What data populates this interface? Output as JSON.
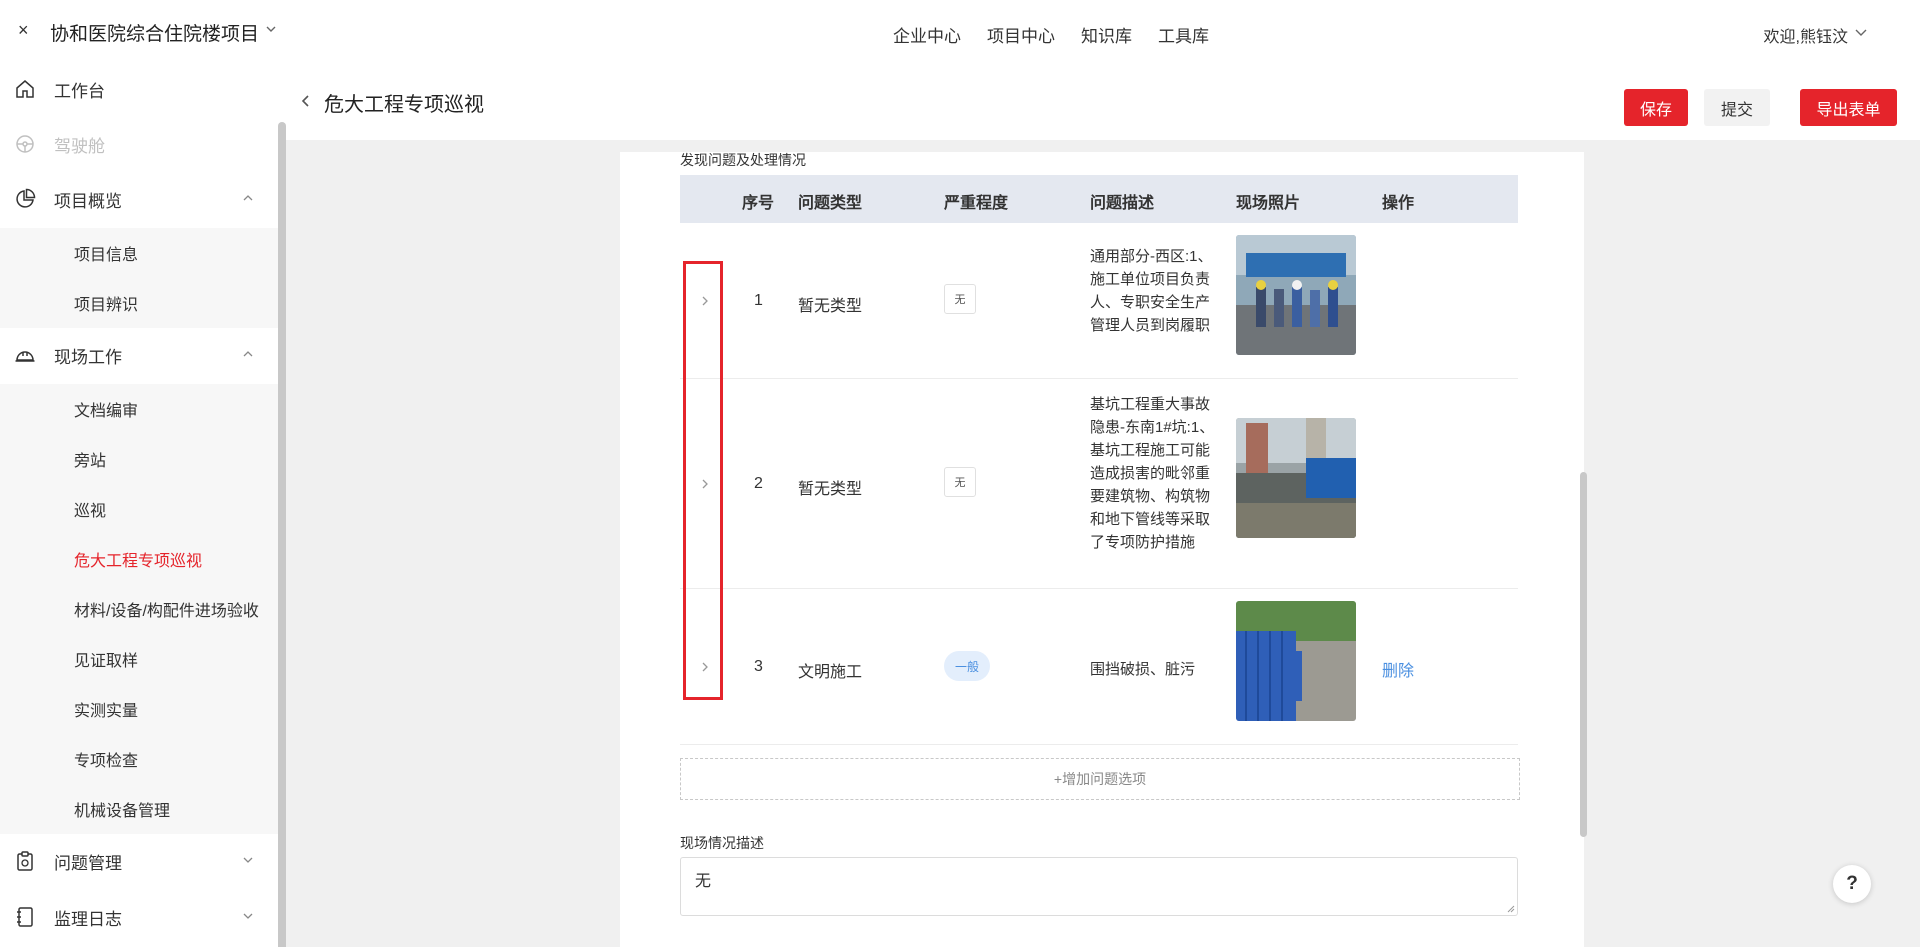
{
  "topbar": {
    "close_symbol": "×",
    "project_title": "协和医院综合住院楼项目",
    "nav": [
      "企业中心",
      "项目中心",
      "知识库",
      "工具库"
    ],
    "active_nav": "项目中心",
    "welcome": "欢迎,熊钰汶"
  },
  "sidebar": {
    "items": [
      {
        "label": "工作台",
        "icon": "home-icon"
      },
      {
        "label": "驾驶舱",
        "icon": "steering-wheel-icon",
        "disabled": true
      },
      {
        "label": "项目概览",
        "icon": "pie-chart-icon",
        "expanded": true
      },
      {
        "label": "项目信息"
      },
      {
        "label": "项目辨识"
      },
      {
        "label": "现场工作",
        "icon": "helmet-icon",
        "expanded": true
      },
      {
        "label": "文档编审"
      },
      {
        "label": "旁站"
      },
      {
        "label": "巡视"
      },
      {
        "label": "危大工程专项巡视",
        "active": true
      },
      {
        "label": "材料/设备/构配件进场验收"
      },
      {
        "label": "见证取样"
      },
      {
        "label": "实测实量"
      },
      {
        "label": "专项检查"
      },
      {
        "label": "机械设备管理"
      },
      {
        "label": "问题管理",
        "icon": "clipboard-icon",
        "expanded": false
      },
      {
        "label": "监理日志",
        "icon": "notebook-icon",
        "expanded": false
      }
    ]
  },
  "header": {
    "page_title": "危大工程专项巡视",
    "save_label": "保存",
    "submit_label": "提交",
    "export_label": "导出表单"
  },
  "issues": {
    "section_label": "发现问题及处理情况",
    "columns": [
      "序号",
      "问题类型",
      "严重程度",
      "问题描述",
      "现场照片",
      "操作"
    ],
    "rows": [
      {
        "index": "1",
        "type": "暂无类型",
        "severity": "无",
        "description": "通用部分-西区:1、施工单位项目负责人、专职安全生产管理人员到岗履职",
        "action": ""
      },
      {
        "index": "2",
        "type": "暂无类型",
        "severity": "无",
        "description": "基坑工程重大事故隐患-东南1#坑:1、基坑工程施工可能造成损害的毗邻重要建筑物、构筑物和地下管线等采取了专项防护措施",
        "action": ""
      },
      {
        "index": "3",
        "type": "文明施工",
        "severity": "一般",
        "description": "围挡破损、脏污",
        "action": "删除"
      }
    ],
    "add_label": "+增加问题选项"
  },
  "scene": {
    "label": "现场情况描述",
    "value": "无"
  },
  "help": "?"
}
